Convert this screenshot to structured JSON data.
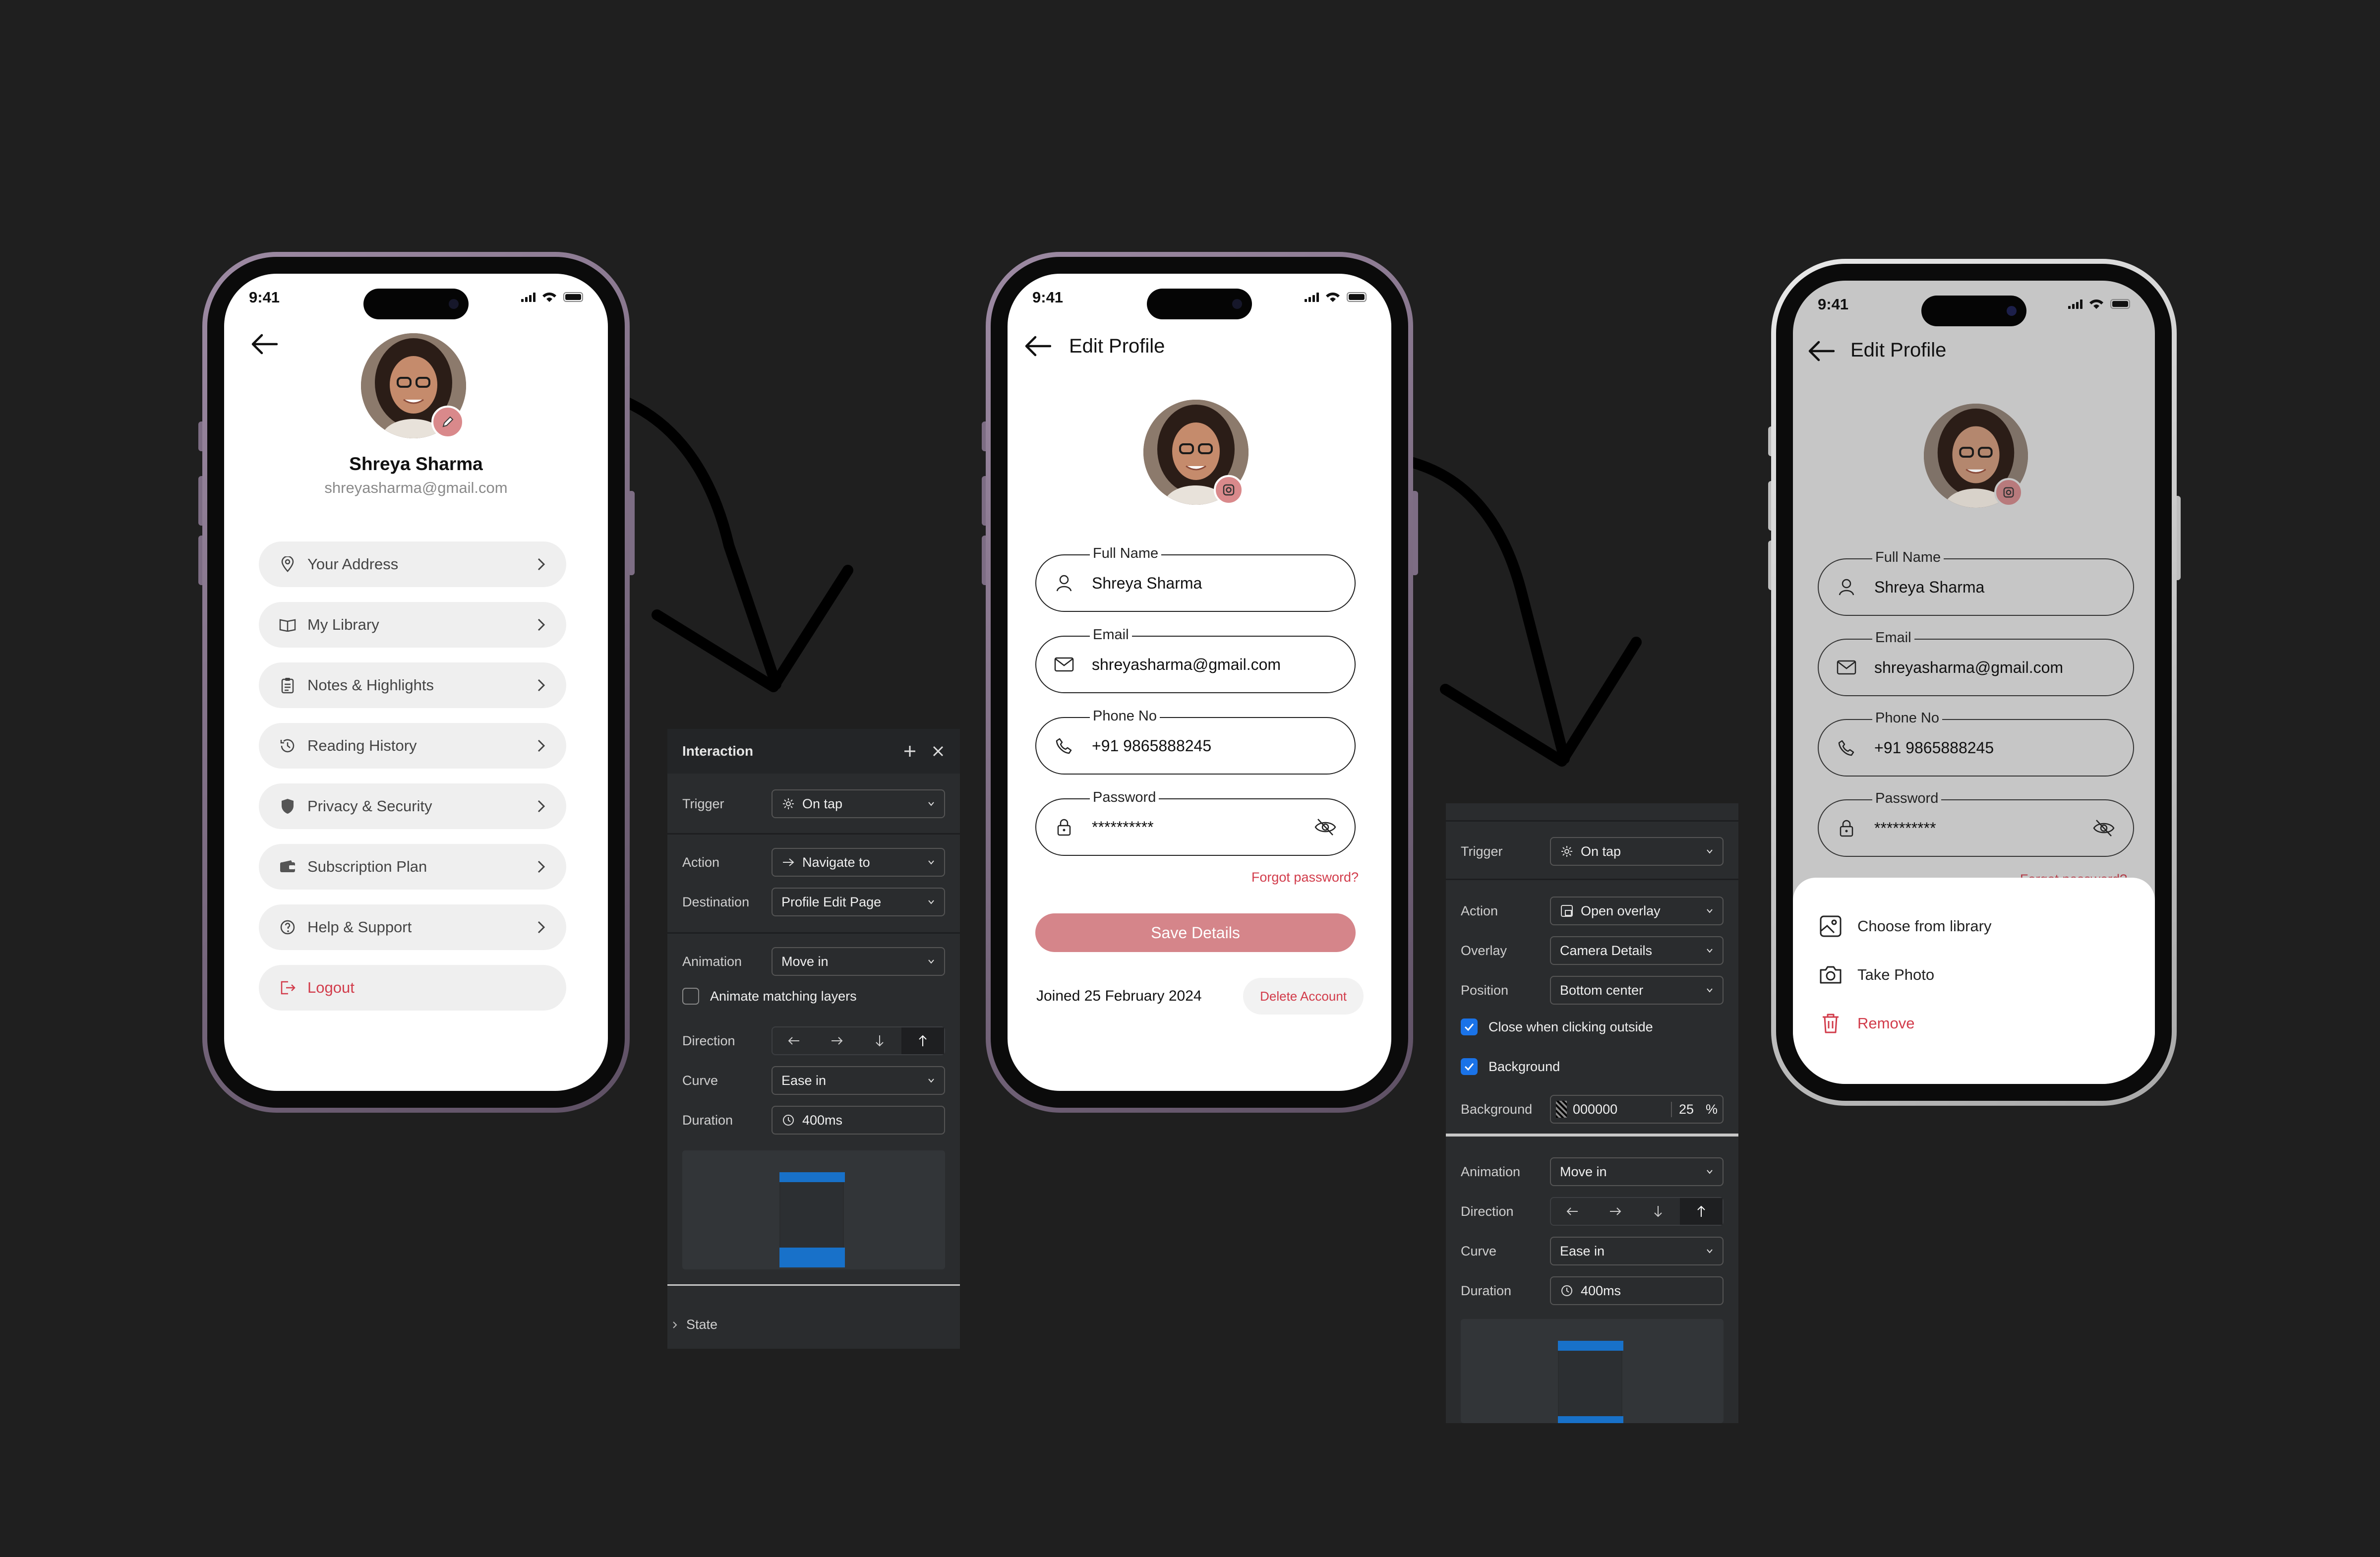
{
  "phone1": {
    "status_time": "9:41",
    "profile": {
      "name": "Shreya Sharma",
      "email": "shreyasharma@gmail.com"
    },
    "menu": [
      {
        "label": "Your Address",
        "icon": "location-pin-icon"
      },
      {
        "label": "My Library",
        "icon": "book-icon"
      },
      {
        "label": "Notes & Highlights",
        "icon": "clipboard-icon"
      },
      {
        "label": "Reading History",
        "icon": "history-icon"
      },
      {
        "label": "Privacy & Security",
        "icon": "shield-icon"
      },
      {
        "label": "Subscription Plan",
        "icon": "wallet-icon"
      },
      {
        "label": "Help & Support",
        "icon": "help-icon"
      },
      {
        "label": "Logout",
        "icon": "logout-icon"
      }
    ]
  },
  "phone2": {
    "status_time": "9:41",
    "title": "Edit Profile",
    "fields": [
      {
        "label": "Full Name",
        "value": "Shreya Sharma",
        "icon": "user-icon"
      },
      {
        "label": "Email",
        "value": "shreyasharma@gmail.com",
        "icon": "mail-icon"
      },
      {
        "label": "Phone No",
        "value": "+91 9865888245",
        "icon": "phone-icon"
      },
      {
        "label": "Password",
        "value": "**********",
        "icon": "lock-icon"
      }
    ],
    "forgot": "Forgot password?",
    "save": "Save Details",
    "joined": "Joined 25 February 2024",
    "delete": "Delete Account"
  },
  "phone3": {
    "status_time": "9:41",
    "title": "Edit Profile",
    "fields": [
      {
        "label": "Full Name",
        "value": "Shreya Sharma"
      },
      {
        "label": "Email",
        "value": "shreyasharma@gmail.com"
      },
      {
        "label": "Phone No",
        "value": "+91 9865888245"
      },
      {
        "label": "Password",
        "value": "**********"
      }
    ],
    "forgot": "Forgot password?",
    "sheet": [
      {
        "label": "Choose from library",
        "icon": "image-icon"
      },
      {
        "label": "Take Photo",
        "icon": "camera-icon"
      },
      {
        "label": "Remove",
        "icon": "trash-icon"
      }
    ]
  },
  "panel1": {
    "header": "Interaction",
    "trigger_label": "Trigger",
    "trigger_value": "On tap",
    "action_label": "Action",
    "action_value": "Navigate to",
    "destination_label": "Destination",
    "destination_value": "Profile Edit Page",
    "animation_label": "Animation",
    "animation_value": "Move in",
    "animate_matching": "Animate matching layers",
    "direction_label": "Direction",
    "curve_label": "Curve",
    "curve_value": "Ease in",
    "duration_label": "Duration",
    "duration_value": "400ms",
    "state_label": "State"
  },
  "panel2": {
    "trigger_label": "Trigger",
    "trigger_value": "On tap",
    "action_label": "Action",
    "action_value": "Open overlay",
    "overlay_label": "Overlay",
    "overlay_value": "Camera Details",
    "position_label": "Position",
    "position_value": "Bottom center",
    "close_outside": "Close when clicking outside",
    "background_check": "Background",
    "background_label": "Background",
    "background_hex": "000000",
    "background_opacity": "25",
    "background_unit": "%",
    "animation_label": "Animation",
    "animation_value": "Move in",
    "direction_label": "Direction",
    "curve_label": "Curve",
    "curve_value": "Ease in",
    "duration_label": "Duration",
    "duration_value": "400ms"
  },
  "colors": {
    "accent": "#D5858A",
    "danger": "#D23C4B",
    "panel": "#2A2C2E",
    "canvas": "#1F1F1F",
    "blue": "#1871C9"
  }
}
